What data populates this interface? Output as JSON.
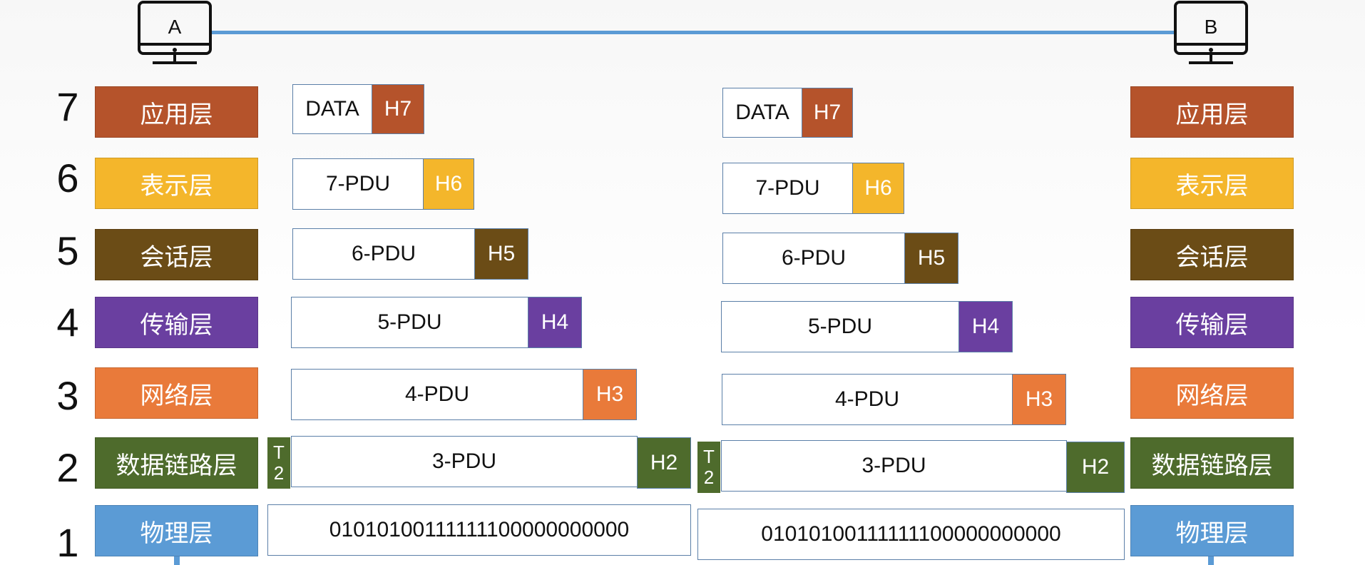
{
  "hosts": {
    "a": "A",
    "b": "B"
  },
  "layers": [
    {
      "num": "7",
      "name": "应用层",
      "color": "#b5532b",
      "hcolor": "#b5532b"
    },
    {
      "num": "6",
      "name": "表示层",
      "color": "#f4b62b",
      "hcolor": "#f4b62b"
    },
    {
      "num": "5",
      "name": "会话层",
      "color": "#6b4c16",
      "hcolor": "#6b4c16"
    },
    {
      "num": "4",
      "name": "传输层",
      "color": "#6a3fa0",
      "hcolor": "#6a3fa0"
    },
    {
      "num": "3",
      "name": "网络层",
      "color": "#e97a3a",
      "hcolor": "#e97a3a"
    },
    {
      "num": "2",
      "name": "数据链路层",
      "color": "#4e6b2c",
      "hcolor": "#4e6b2c"
    },
    {
      "num": "1",
      "name": "物理层",
      "color": "#5b9bd5",
      "hcolor": "#5b9bd5"
    }
  ],
  "pdus": {
    "l7": {
      "data": "DATA",
      "header": "H7"
    },
    "l6": {
      "data": "7-PDU",
      "header": "H6"
    },
    "l5": {
      "data": "6-PDU",
      "header": "H5"
    },
    "l4": {
      "data": "5-PDU",
      "header": "H4"
    },
    "l3": {
      "data": "4-PDU",
      "header": "H3"
    },
    "l2": {
      "data": "3-PDU",
      "header": "H2",
      "trailer_top": "T",
      "trailer_bottom": "2"
    },
    "l1": {
      "bits": "01010100111111100000000000"
    }
  },
  "colors": {
    "link": "#5b9bd5",
    "border": "#5b7fa8"
  }
}
